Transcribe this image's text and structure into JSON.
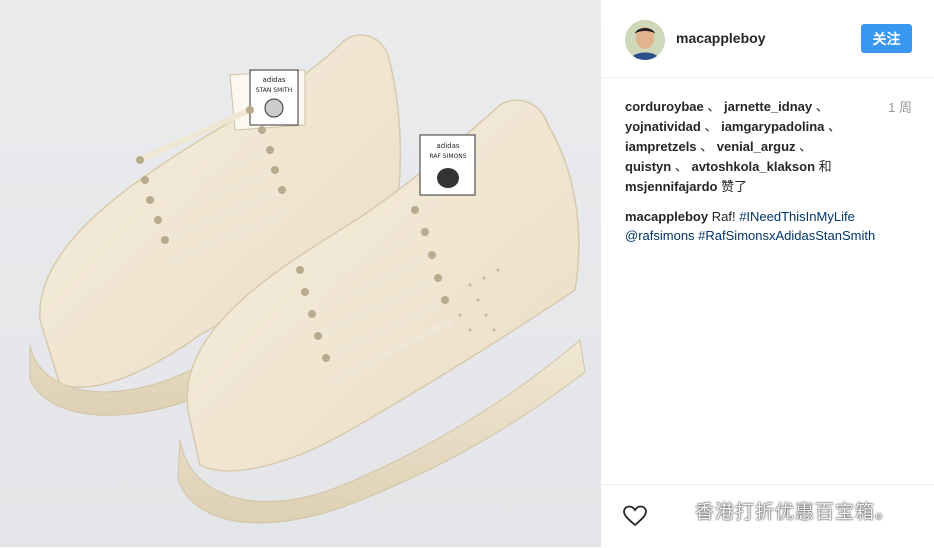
{
  "post": {
    "username": "macappleboy",
    "follow_label": "关注",
    "time_ago": "1 周",
    "likes": [
      {
        "user": "corduroybae",
        "sep": " 、 "
      },
      {
        "user": "jarnette_idnay",
        "sep": " 、"
      },
      {
        "user": "yojnatividad",
        "sep": " 、 "
      },
      {
        "user": "iamgarypadolina",
        "sep": " 、"
      },
      {
        "user": "iampretzels",
        "sep": " 、 "
      },
      {
        "user": "venial_arguz",
        "sep": " 、"
      },
      {
        "user": "quistyn",
        "sep": " 、 "
      },
      {
        "user": "avtoshkola_klakson",
        "sep": " 和"
      },
      {
        "user": "msjennifajardo",
        "sep": " 赞了"
      }
    ],
    "caption": {
      "user": "macappleboy",
      "text": "Raf!",
      "tag1": "#INeedThisInMyLife",
      "mention": "@rafsimons",
      "tag2": "#RafSimonsxAdidasStanSmith"
    }
  },
  "watermark": {
    "text": "香港打折优惠百宝箱。",
    "icon": "wechat-icon"
  },
  "shoe_tongue": {
    "brand": "adidas",
    "model_left": "STAN SMITH",
    "model_right": "RAF SIMONS"
  },
  "icons": {
    "like": "heart-icon"
  },
  "colors": {
    "follow_bg": "#3897f0",
    "hashtag": "#003569"
  }
}
